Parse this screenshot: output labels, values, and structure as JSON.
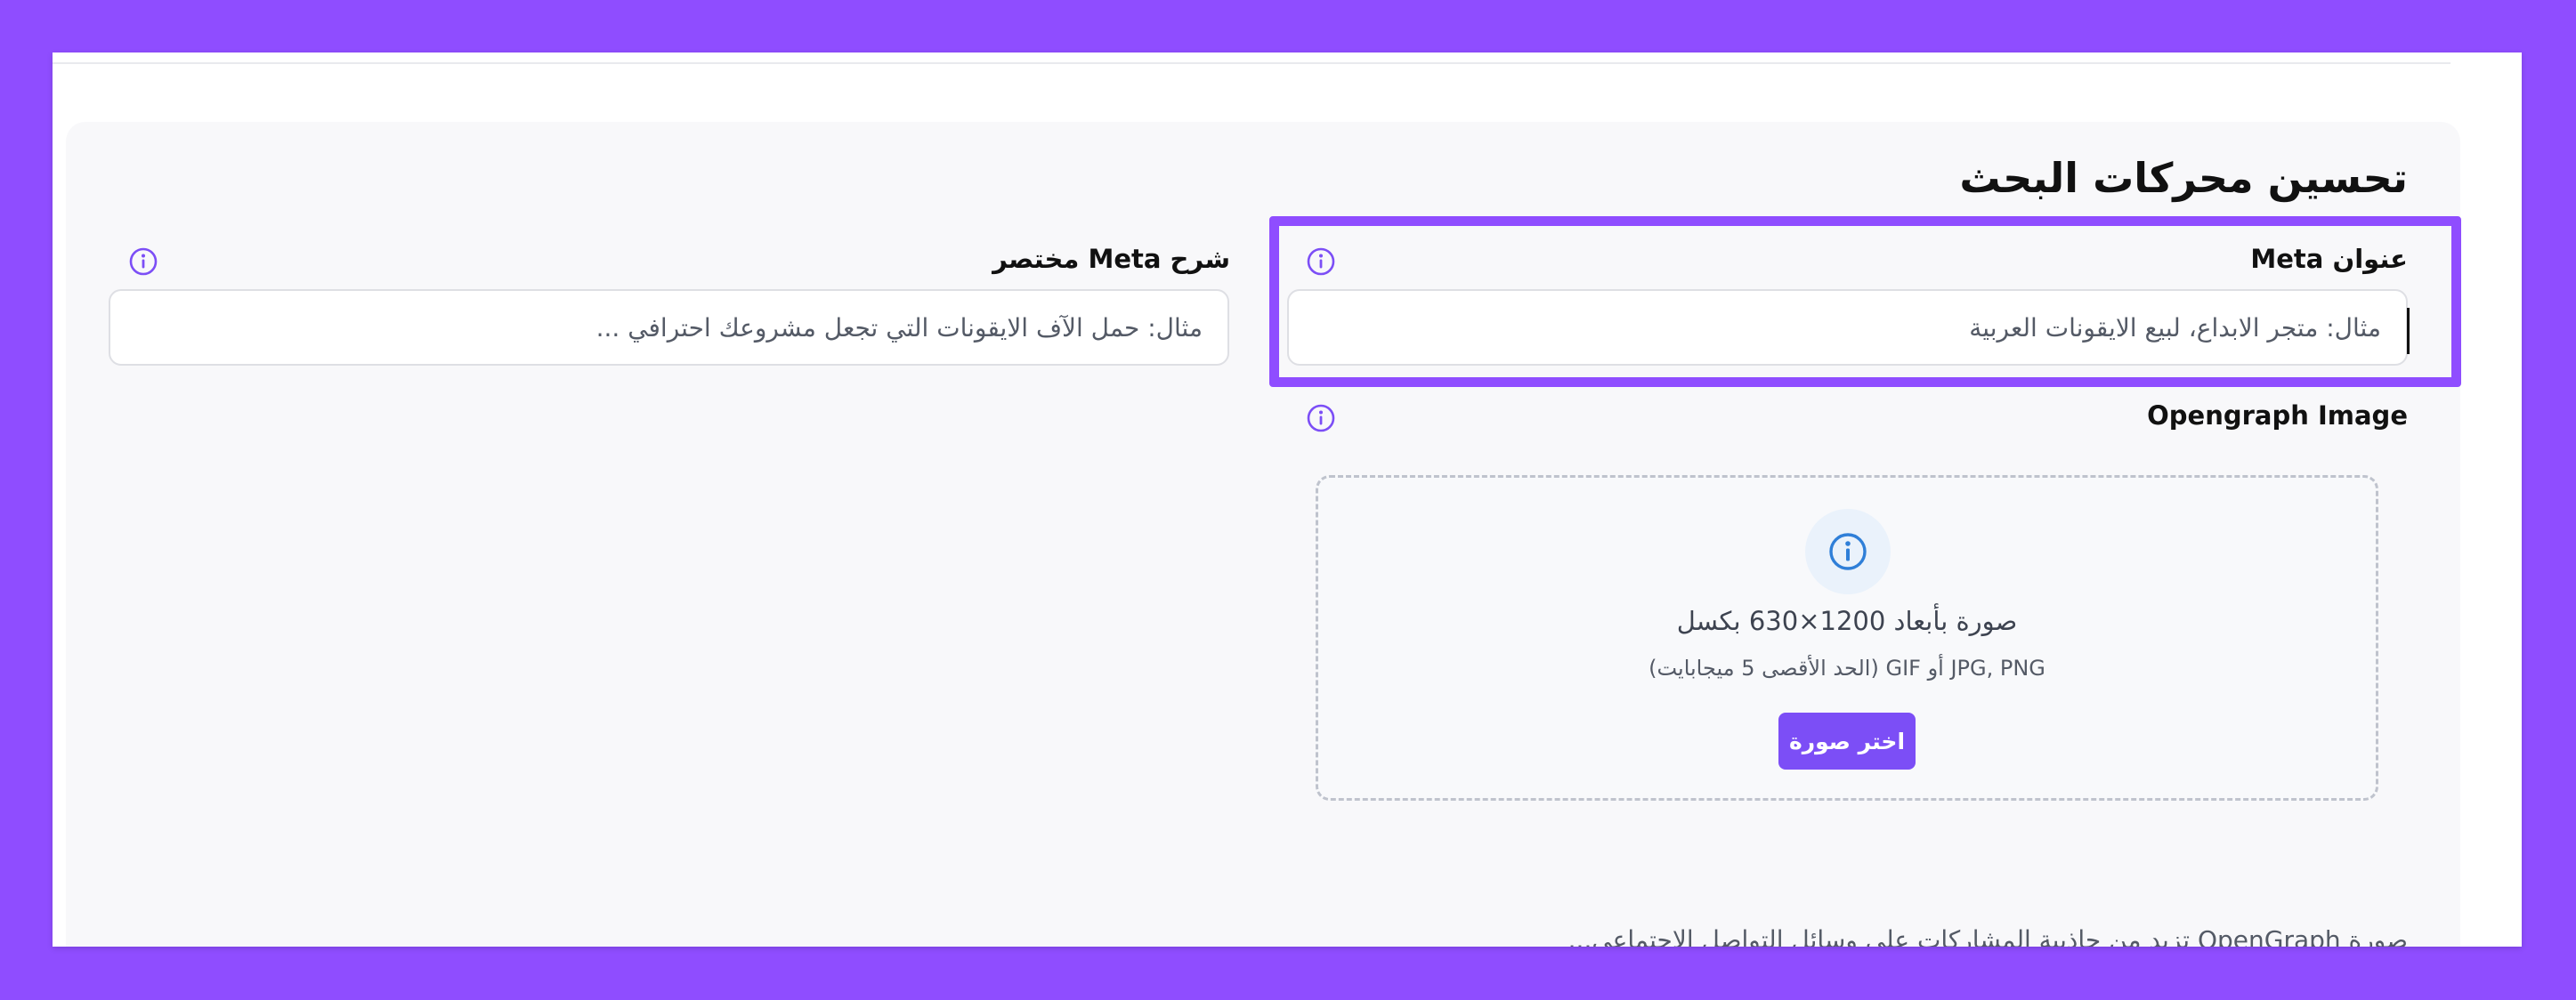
{
  "seo": {
    "title": "تحسين محركات البحث",
    "meta_title": {
      "label": "عنوان Meta",
      "placeholder": "مثال: متجر الابداع، لبيع الايقونات العربية"
    },
    "meta_description": {
      "label": "شرح Meta مختصر",
      "placeholder": "مثال: حمل الآف الايقونات التي تجعل مشروعك احترافي ..."
    },
    "og_image": {
      "label": "Opengraph Image",
      "dimensions_text": "صورة بأبعاد 1200×630 بكسل",
      "formats_text": "JPG, PNG أو GIF (الحد الأقصى 5 ميجابايت)",
      "button_label": "اختر صورة",
      "help_text": "صورة OpenGraph تزيد من جاذبية المشاركات على وسائل التواصل الاجتماعي..."
    }
  },
  "icons": {
    "info": "info-icon"
  },
  "colors": {
    "frame": "#8f4dff",
    "accent": "#7c4ef6",
    "info_icon": "#7c4ef6",
    "upload_icon": "#2f7fd8"
  }
}
